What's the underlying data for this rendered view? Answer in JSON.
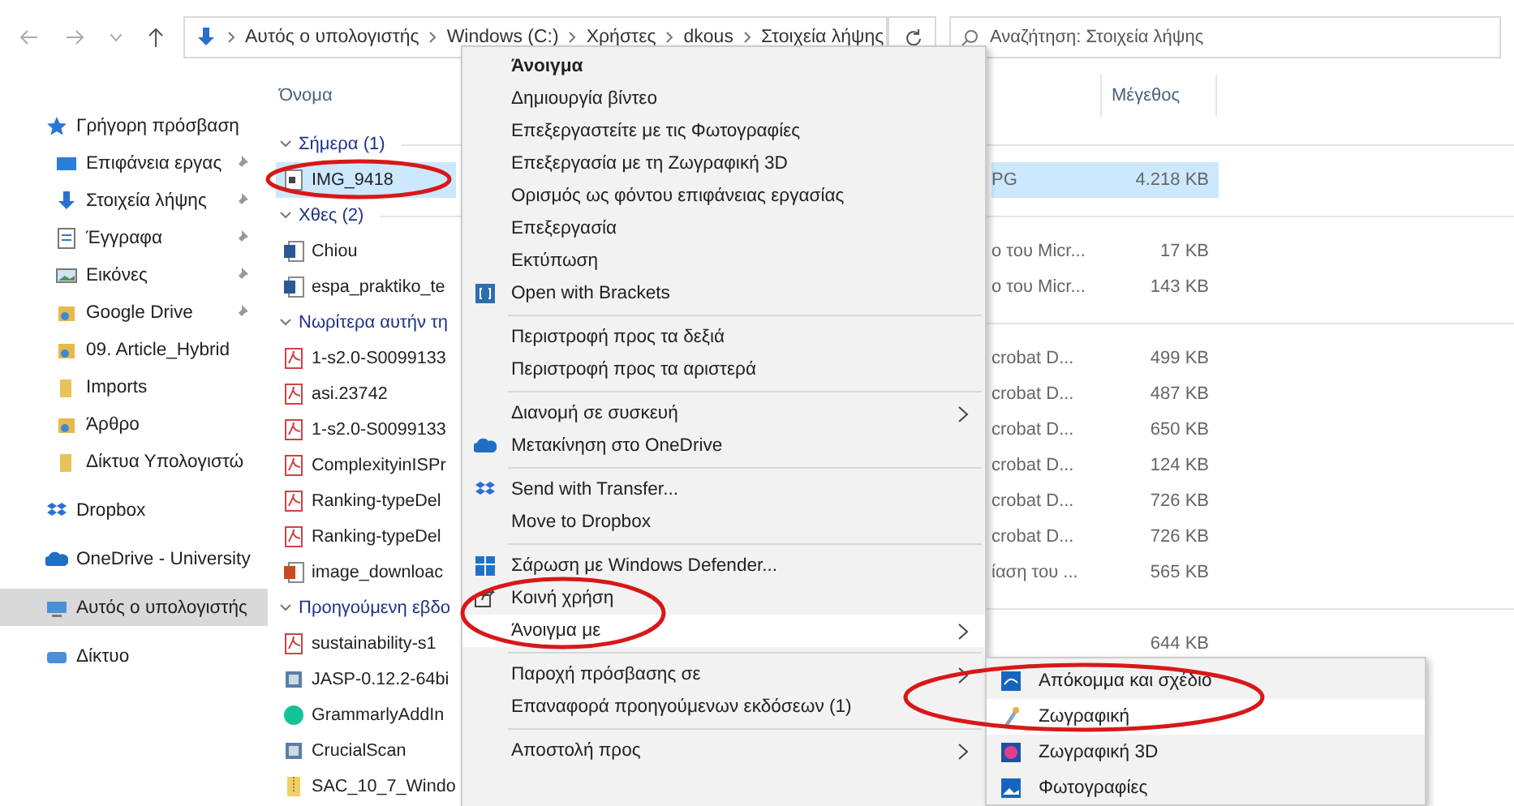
{
  "toolbar": {
    "breadcrumbs": [
      "Αυτός ο υπολογιστής",
      "Windows (C:)",
      "Χρήστες",
      "dkous",
      "Στοιχεία λήψης"
    ],
    "search": {
      "placeholder": "Αναζήτηση: Στοιχεία λήψης"
    }
  },
  "sidebar": {
    "items": [
      {
        "label": "Γρήγορη πρόσβαση",
        "kind": "root",
        "pinned": false,
        "selected": false
      },
      {
        "label": "Επιφάνεια εργας",
        "kind": "item",
        "pinned": true,
        "selected": false
      },
      {
        "label": "Στοιχεία λήψης",
        "kind": "item",
        "pinned": true,
        "selected": false
      },
      {
        "label": "Έγγραφα",
        "kind": "item",
        "pinned": true,
        "selected": false
      },
      {
        "label": "Εικόνες",
        "kind": "item",
        "pinned": true,
        "selected": false
      },
      {
        "label": "Google Drive",
        "kind": "item",
        "pinned": true,
        "selected": false
      },
      {
        "label": "09. Article_Hybrid",
        "kind": "item",
        "pinned": false,
        "selected": false
      },
      {
        "label": "Imports",
        "kind": "item",
        "pinned": false,
        "selected": false
      },
      {
        "label": "Άρθρο",
        "kind": "item",
        "pinned": false,
        "selected": false
      },
      {
        "label": "Δίκτυα Υπολογιστώ",
        "kind": "item",
        "pinned": false,
        "selected": false
      },
      {
        "label": "Dropbox",
        "kind": "root",
        "pinned": false,
        "selected": false
      },
      {
        "label": "OneDrive - University",
        "kind": "root",
        "pinned": false,
        "selected": false
      },
      {
        "label": "Αυτός ο υπολογιστής",
        "kind": "root",
        "pinned": false,
        "selected": true
      },
      {
        "label": "Δίκτυο",
        "kind": "root",
        "pinned": false,
        "selected": false
      }
    ]
  },
  "table": {
    "columns": [
      "Όνομα",
      "Μέγεθος"
    ],
    "rows": [
      {
        "kind": "group",
        "name": "Σήμερα (1)"
      },
      {
        "kind": "file",
        "name": "IMG_9418",
        "type": "PG",
        "size": "4.218 KB",
        "selected": true
      },
      {
        "kind": "group",
        "name": "Χθες (2)"
      },
      {
        "kind": "file",
        "name": "Chiou",
        "type": "ο του Micr...",
        "size": "17 KB",
        "selected": false
      },
      {
        "kind": "file",
        "name": "espa_praktiko_te",
        "type": "ο του Micr...",
        "size": "143 KB",
        "selected": false
      },
      {
        "kind": "group",
        "name": "Νωρίτερα αυτήν τη"
      },
      {
        "kind": "file",
        "name": "1-s2.0-S0099133",
        "type": "crobat D...",
        "size": "499 KB",
        "selected": false
      },
      {
        "kind": "file",
        "name": "asi.23742",
        "type": "crobat D...",
        "size": "487 KB",
        "selected": false
      },
      {
        "kind": "file",
        "name": "1-s2.0-S0099133",
        "type": "crobat D...",
        "size": "650 KB",
        "selected": false
      },
      {
        "kind": "file",
        "name": "ComplexityinISPr",
        "type": "crobat D...",
        "size": "124 KB",
        "selected": false
      },
      {
        "kind": "file",
        "name": "Ranking-typeDel",
        "type": "crobat D...",
        "size": "726 KB",
        "selected": false
      },
      {
        "kind": "file",
        "name": "Ranking-typeDel",
        "type": "crobat D...",
        "size": "726 KB",
        "selected": false
      },
      {
        "kind": "file",
        "name": "image_downloac",
        "type": "ίαση του ...",
        "size": "565 KB",
        "selected": false
      },
      {
        "kind": "group",
        "name": "Προηγούμενη εβδο"
      },
      {
        "kind": "file",
        "name": "sustainability-s1",
        "size": "644 KB",
        "selected": false
      },
      {
        "kind": "file",
        "name": "JASP-0.12.2-64bi",
        "selected": false
      },
      {
        "kind": "file",
        "name": "GrammarlyAddIn",
        "selected": false
      },
      {
        "kind": "file",
        "name": "CrucialScan",
        "selected": false
      },
      {
        "kind": "file",
        "name": "SAC_10_7_Windo",
        "selected": false
      }
    ]
  },
  "context_menu": {
    "items": [
      {
        "kind": "default",
        "label": "Άνοιγμα",
        "has_submenu": false,
        "selected": false
      },
      {
        "kind": "item",
        "label": "Δημιουργία βίντεο",
        "has_submenu": false,
        "selected": false
      },
      {
        "kind": "item",
        "label": "Επεξεργαστείτε με τις Φωτογραφίες",
        "has_submenu": false,
        "selected": false
      },
      {
        "kind": "item",
        "label": "Επεξεργασία με τη Ζωγραφική 3D",
        "has_submenu": false,
        "selected": false
      },
      {
        "kind": "item",
        "label": "Ορισμός ως φόντου επιφάνειας εργασίας",
        "has_submenu": false,
        "selected": false
      },
      {
        "kind": "item",
        "label": "Επεξεργασία",
        "has_submenu": false,
        "selected": false
      },
      {
        "kind": "item",
        "label": "Εκτύπωση",
        "has_submenu": false,
        "selected": false
      },
      {
        "kind": "item",
        "label": "Open with Brackets",
        "has_submenu": false,
        "selected": false
      },
      {
        "kind": "separator"
      },
      {
        "kind": "item",
        "label": "Περιστροφή προς τα δεξιά",
        "has_submenu": false,
        "selected": false
      },
      {
        "kind": "item",
        "label": "Περιστροφή προς τα αριστερά",
        "has_submenu": false,
        "selected": false
      },
      {
        "kind": "separator"
      },
      {
        "kind": "item",
        "label": "Διανομή σε συσκευή",
        "has_submenu": true,
        "selected": false
      },
      {
        "kind": "item",
        "label": "Μετακίνηση στο OneDrive",
        "has_submenu": false,
        "selected": false
      },
      {
        "kind": "separator"
      },
      {
        "kind": "item",
        "label": "Send with Transfer...",
        "has_submenu": false,
        "selected": false
      },
      {
        "kind": "item",
        "label": "Move to Dropbox",
        "has_submenu": false,
        "selected": false
      },
      {
        "kind": "separator"
      },
      {
        "kind": "item",
        "label": "Σάρωση με Windows Defender...",
        "has_submenu": false,
        "selected": false
      },
      {
        "kind": "item",
        "label": "Κοινή χρήση",
        "has_submenu": false,
        "selected": false
      },
      {
        "kind": "item",
        "label": "Άνοιγμα με",
        "has_submenu": true,
        "selected": true
      },
      {
        "kind": "separator"
      },
      {
        "kind": "item",
        "label": "Παροχή πρόσβασης σε",
        "has_submenu": true,
        "selected": false
      },
      {
        "kind": "item",
        "label": "Επαναφορά προηγούμενων εκδόσεων (1)",
        "has_submenu": false,
        "selected": false
      },
      {
        "kind": "separator"
      },
      {
        "kind": "item",
        "label": "Αποστολή προς",
        "has_submenu": true,
        "selected": false
      }
    ]
  },
  "submenu": {
    "items": [
      {
        "label": "Απόκομμα και σχέδιο",
        "selected": false
      },
      {
        "label": "Ζωγραφική",
        "selected": true
      },
      {
        "label": "Ζωγραφική 3D",
        "selected": false
      },
      {
        "label": "Φωτογραφίες",
        "selected": false
      }
    ]
  }
}
